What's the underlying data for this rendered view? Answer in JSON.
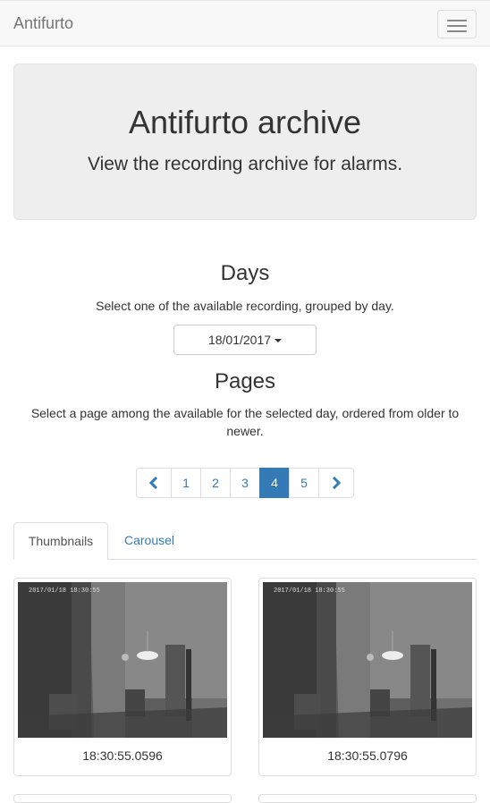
{
  "navbar": {
    "brand": "Antifurto"
  },
  "jumbotron": {
    "title": "Antifurto archive",
    "subtitle": "View the recording archive for alarms."
  },
  "days": {
    "title": "Days",
    "description": "Select one of the available recording, grouped by day.",
    "selected_day": "18/01/2017"
  },
  "pages": {
    "title": "Pages",
    "description": "Select a page among the available for the selected day, ordered from older to newer.",
    "items": [
      "1",
      "2",
      "3",
      "4",
      "5"
    ],
    "active": "4"
  },
  "tabs": [
    {
      "label": "Thumbnails",
      "active": true
    },
    {
      "label": "Carousel",
      "active": false
    }
  ],
  "thumbnails": [
    {
      "timestamp_overlay": "2017/01/18 18:30:55",
      "caption": "18:30:55.0596"
    },
    {
      "timestamp_overlay": "2017/01/18 18:30:55",
      "caption": "18:30:55.0796"
    }
  ],
  "colors": {
    "primary": "#337ab7",
    "jumbotron_bg": "#eeeeee",
    "navbar_bg": "#f8f8f8"
  },
  "icons": {
    "prev": "chevron-left-icon",
    "next": "chevron-right-icon",
    "menu": "hamburger-menu-icon"
  }
}
